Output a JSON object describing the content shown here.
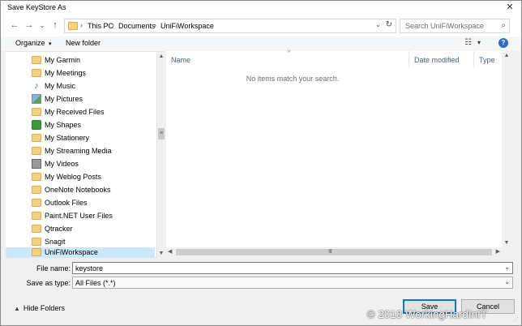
{
  "window": {
    "title": "Save KeyStore As",
    "close_label": "✕"
  },
  "nav": {
    "back_icon": "←",
    "forward_icon": "→",
    "dropdown_icon": "⌄",
    "up_icon": "↑",
    "breadcrumbs": [
      "This PC",
      "Documents",
      "UniFiWorkspace"
    ],
    "separator": "›",
    "address_dropdown": "⌄",
    "refresh_icon": "↻",
    "search_placeholder": "Search UniFiWorkspace",
    "search_icon": "⌕"
  },
  "toolbar": {
    "organize_label": "Organize",
    "organize_caret": "▾",
    "new_folder_label": "New folder",
    "view_icon": "☷",
    "view_caret": "▾",
    "help_label": "?"
  },
  "sidebar": {
    "items": [
      {
        "label": "My Garmin",
        "icon": "folder"
      },
      {
        "label": "My Meetings",
        "icon": "folder"
      },
      {
        "label": "My Music",
        "icon": "music"
      },
      {
        "label": "My Pictures",
        "icon": "pictures"
      },
      {
        "label": "My Received Files",
        "icon": "folder"
      },
      {
        "label": "My Shapes",
        "icon": "shapes"
      },
      {
        "label": "My Stationery",
        "icon": "folder"
      },
      {
        "label": "My Streaming Media",
        "icon": "folder"
      },
      {
        "label": "My Videos",
        "icon": "videos"
      },
      {
        "label": "My Weblog Posts",
        "icon": "folder"
      },
      {
        "label": "OneNote Notebooks",
        "icon": "folder"
      },
      {
        "label": "Outlook Files",
        "icon": "folder"
      },
      {
        "label": "Paint.NET User Files",
        "icon": "folder"
      },
      {
        "label": "Qtracker",
        "icon": "folder"
      },
      {
        "label": "Snagit",
        "icon": "folder"
      },
      {
        "label": "UniFiWorkspace",
        "icon": "folder",
        "selected": true
      }
    ],
    "music_glyph": "♪",
    "scroll_up": "▲",
    "scroll_down": "▼",
    "scroll_grip": "≡"
  },
  "filelist": {
    "columns": [
      "Name",
      "Date modified",
      "Type"
    ],
    "sort_indicator": "^",
    "empty_message": "No items match your search.",
    "scroll_up": "▲",
    "scroll_down": "▼",
    "scroll_left": "◀",
    "scroll_right": "▶",
    "scroll_grip": "Ⅲ"
  },
  "form": {
    "file_name_label": "File name:",
    "file_name_value": "keystore",
    "save_type_label": "Save as type:",
    "save_type_value": "All Files (*.*)",
    "dropdown_icon": "⌄"
  },
  "footer": {
    "hide_folders_label": "Hide Folders",
    "hide_folders_icon": "▲",
    "save_label": "Save",
    "cancel_label": "Cancel",
    "watermark": "© 2018 WorkingHardInIT",
    "resize_grip": "⋰"
  },
  "colors": {
    "selection": "#cce8ff",
    "accent": "#0078d7",
    "folder": "#f3d27a"
  }
}
